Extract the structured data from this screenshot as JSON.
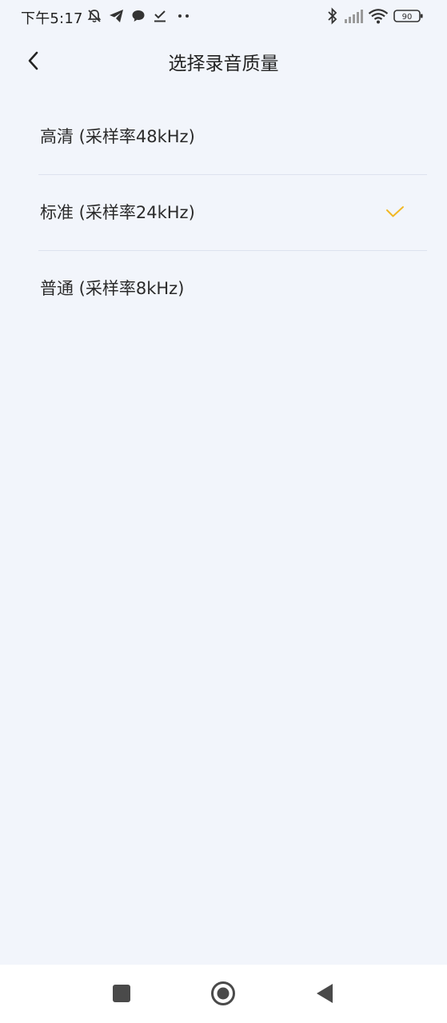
{
  "status_bar": {
    "time": "下午5:17",
    "battery": "90",
    "icons": [
      "bell-muted-icon",
      "telegram-icon",
      "chat-bubble-icon",
      "download-check-icon",
      "more-dots-icon",
      "bluetooth-icon",
      "signal-icon",
      "wifi-icon",
      "battery-icon"
    ]
  },
  "header": {
    "title": "选择录音质量",
    "back_icon": "chevron-left-icon"
  },
  "options": [
    {
      "label": "高清 (采样率48kHz)",
      "selected": false
    },
    {
      "label": "标准 (采样率24kHz)",
      "selected": true
    },
    {
      "label": "普通 (采样率8kHz)",
      "selected": false
    }
  ],
  "accent_color": "#f2b824",
  "nav_bar": {
    "icons": [
      "recents-square-icon",
      "home-circle-icon",
      "back-triangle-icon"
    ]
  }
}
